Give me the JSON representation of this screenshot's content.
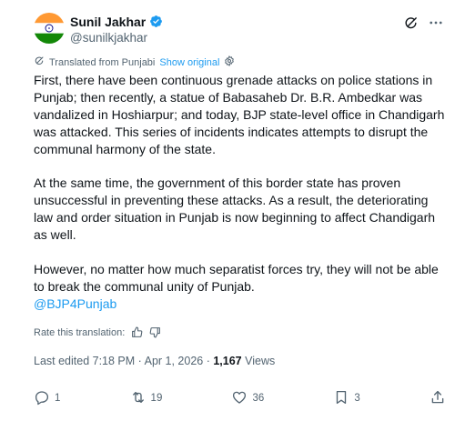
{
  "author": {
    "name": "Sunil Jakhar",
    "handle": "@sunilkjakhar"
  },
  "translation": {
    "label": "Translated from Punjabi",
    "show_original": "Show original"
  },
  "tweet": {
    "paragraphs": [
      "First, there have been continuous grenade attacks on police stations in Punjab; then recently, a statue of Babasaheb Dr. B.R. Ambedkar was vandalized in Hoshiarpur; and today, BJP state-level office in Chandigarh was attacked. This series of incidents indicates attempts to disrupt the communal harmony of the state.",
      "At the same time, the government of this border state has proven unsuccessful in preventing these attacks. As a result, the deteriorating law and order situation in Punjab is now beginning to affect Chandigarh as well.",
      "However, no matter how much separatist forces try, they will not be able to break the communal unity of Punjab."
    ],
    "mention": "@BJP4Punjab"
  },
  "rate": {
    "label": "Rate this translation:"
  },
  "meta": {
    "edited": "Last edited 7:18 PM · Apr 1, 2026 · ",
    "views_count": "1,167",
    "views_label": " Views"
  },
  "actions": {
    "replies": "1",
    "reposts": "19",
    "likes": "36",
    "bookmarks": "3"
  },
  "colors": {
    "accent": "#1d9bf0",
    "secondary": "#536471",
    "flag_saffron": "#ff9933",
    "flag_green": "#138808",
    "flag_navy": "#000080"
  }
}
